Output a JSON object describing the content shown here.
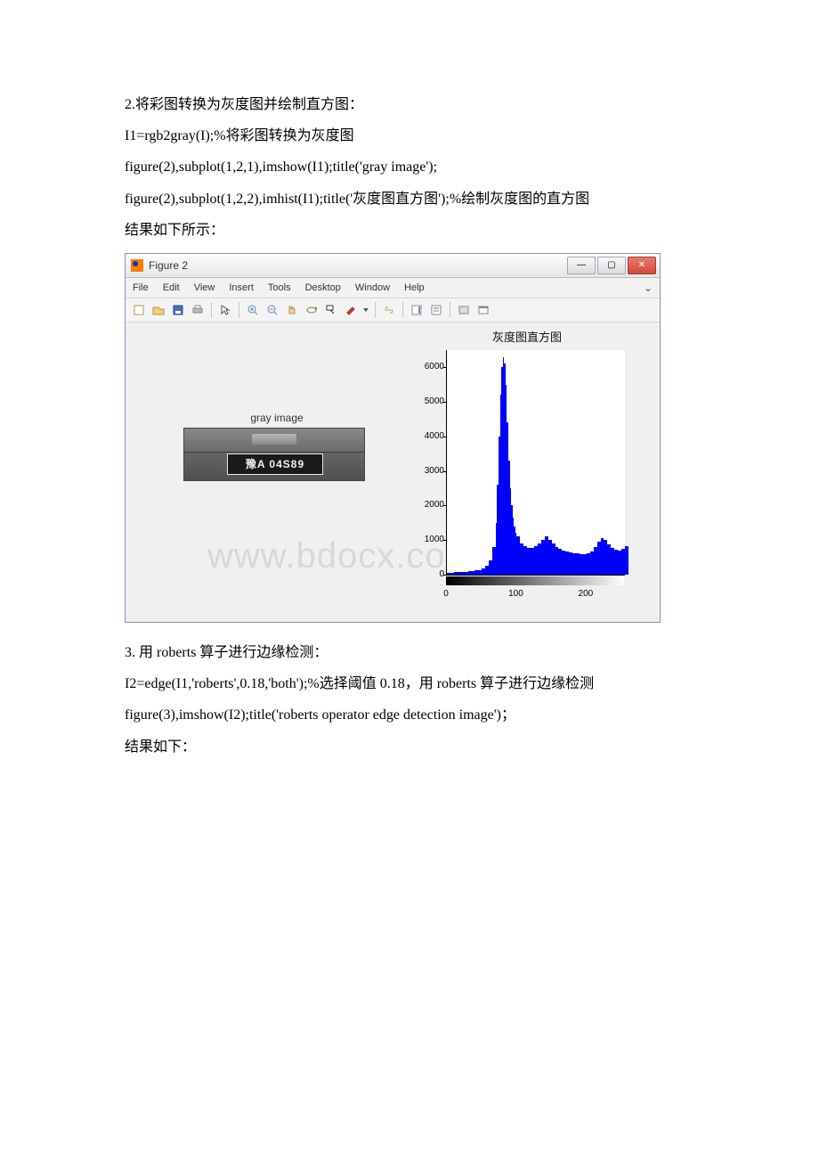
{
  "doc": {
    "p1": "2.将彩图转换为灰度图并绘制直方图：",
    "p2": "I1=rgb2gray(I);%将彩图转换为灰度图",
    "p3": "figure(2),subplot(1,2,1),imshow(I1);title('gray image');",
    "p4": "figure(2),subplot(1,2,2),imhist(I1);title('灰度图直方图');%绘制灰度图的直方图",
    "p5": "结果如下所示：",
    "p6": "3. 用 roberts 算子进行边缘检测：",
    "p7": "I2=edge(I1,'roberts',0.18,'both');%选择阈值 0.18，用 roberts 算子进行边缘检测",
    "p8": "figure(3),imshow(I2);title('roberts operator edge detection image')；",
    "p9": "结果如下："
  },
  "window": {
    "title": "Figure 2",
    "controls": {
      "min": "—",
      "max": "▢",
      "close": "✕"
    },
    "menubar_collapse": "⌄"
  },
  "menu": {
    "items": [
      "File",
      "Edit",
      "View",
      "Insert",
      "Tools",
      "Desktop",
      "Window",
      "Help"
    ]
  },
  "toolbar": {
    "icons": [
      "new-figure-icon",
      "open-icon",
      "save-icon",
      "print-icon",
      "pointer-icon",
      "zoom-in-icon",
      "zoom-out-icon",
      "pan-icon",
      "rotate-3d-icon",
      "data-cursor-icon",
      "brush-icon",
      "link-icon",
      "colorbar-icon",
      "legend-icon",
      "hide-tools-icon",
      "dock-icon"
    ]
  },
  "left_plot": {
    "title": "gray image",
    "plate_text": "豫A 04S89"
  },
  "right_plot": {
    "title": "灰度图直方图"
  },
  "chart_data": {
    "type": "bar",
    "title": "灰度图直方图",
    "xlabel": "",
    "ylabel": "",
    "xlim": [
      0,
      255
    ],
    "ylim": [
      0,
      6500
    ],
    "yticks": [
      0,
      1000,
      2000,
      3000,
      4000,
      5000,
      6000
    ],
    "xticks": [
      0,
      100,
      200
    ],
    "x": [
      0,
      10,
      20,
      30,
      40,
      50,
      55,
      60,
      65,
      70,
      72,
      74,
      76,
      78,
      80,
      82,
      84,
      86,
      88,
      90,
      92,
      94,
      96,
      98,
      100,
      105,
      110,
      115,
      120,
      125,
      130,
      135,
      140,
      145,
      150,
      155,
      160,
      165,
      170,
      175,
      180,
      185,
      190,
      195,
      200,
      205,
      210,
      215,
      220,
      225,
      230,
      235,
      240,
      245,
      250,
      255
    ],
    "values": [
      60,
      70,
      80,
      90,
      120,
      180,
      260,
      420,
      800,
      1500,
      2600,
      4000,
      5200,
      6000,
      6300,
      6100,
      5500,
      4400,
      3300,
      2500,
      2000,
      1650,
      1400,
      1220,
      1100,
      900,
      820,
      780,
      780,
      820,
      900,
      1000,
      1100,
      1000,
      900,
      800,
      740,
      700,
      680,
      650,
      630,
      610,
      600,
      600,
      620,
      680,
      800,
      950,
      1050,
      1000,
      880,
      780,
      720,
      700,
      740,
      820
    ]
  },
  "watermark": "www.bdocx.com"
}
